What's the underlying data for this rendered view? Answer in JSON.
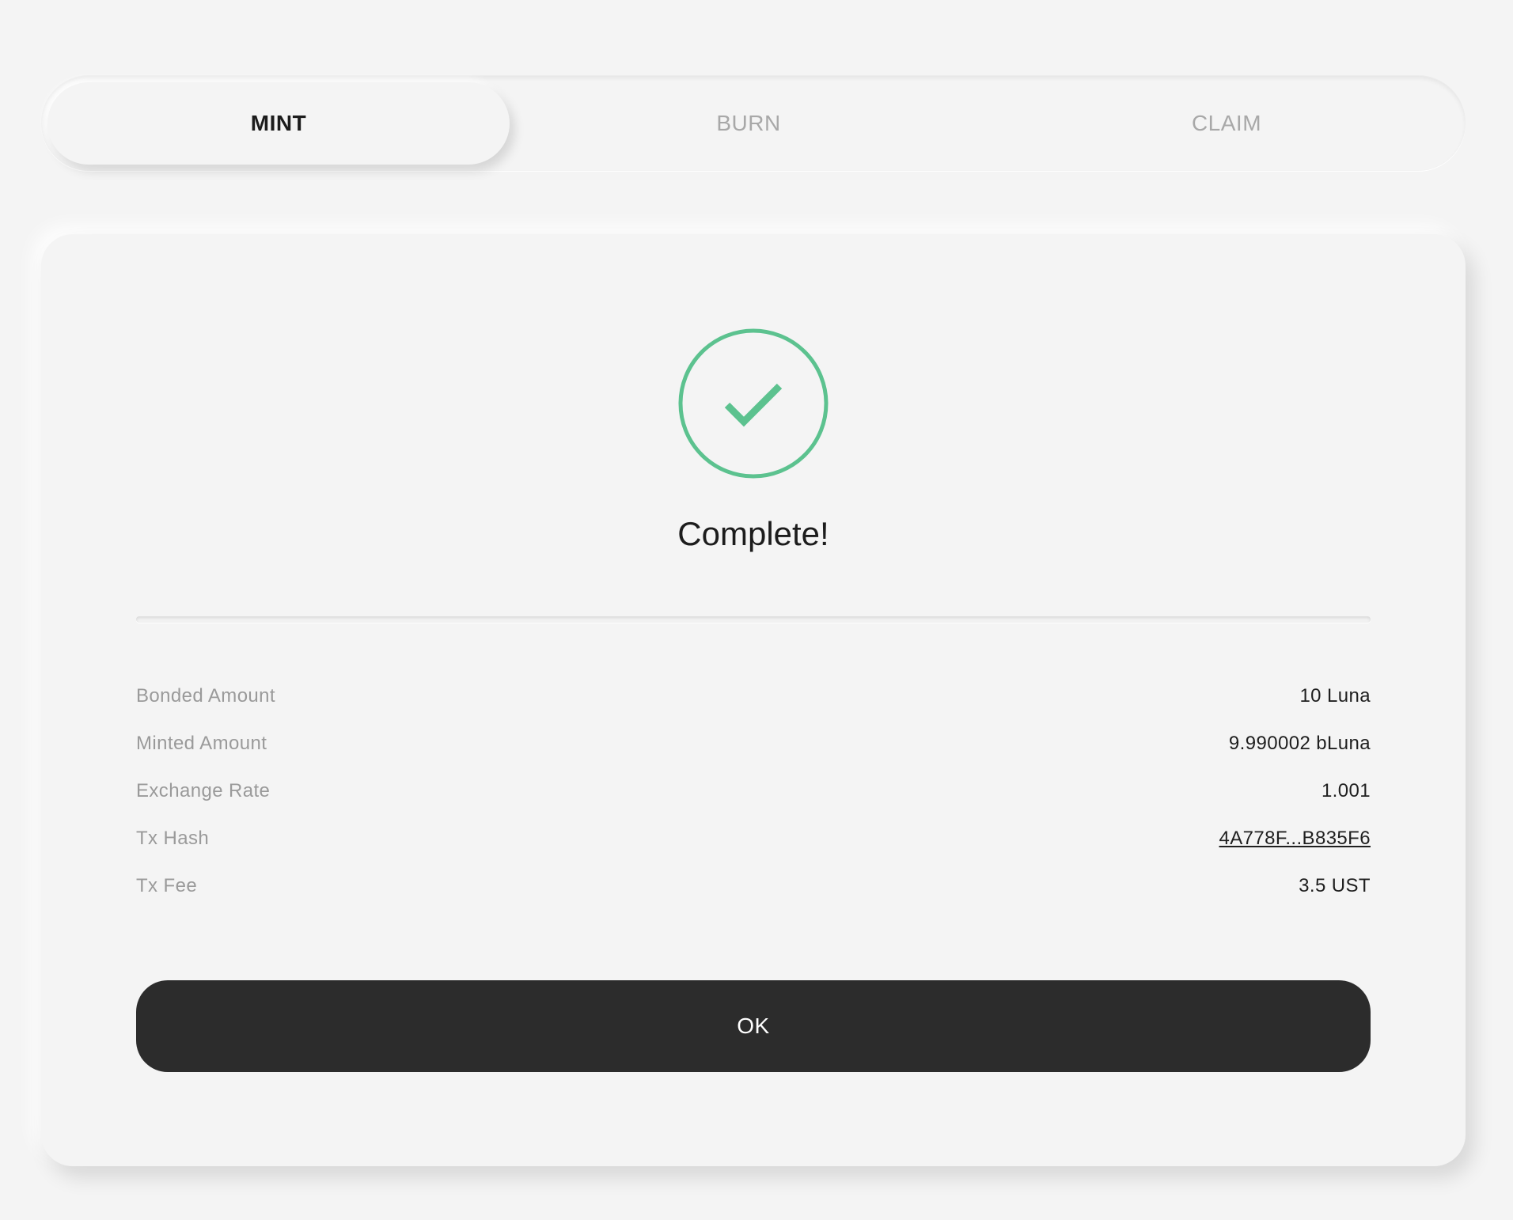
{
  "tabs": [
    {
      "label": "MINT",
      "active": true
    },
    {
      "label": "BURN",
      "active": false
    },
    {
      "label": "CLAIM",
      "active": false
    }
  ],
  "status": {
    "icon": "check-circle-icon",
    "color": "#5cc28f",
    "title": "Complete!"
  },
  "details": [
    {
      "label": "Bonded Amount",
      "value": "10 Luna"
    },
    {
      "label": "Minted Amount",
      "value": "9.990002 bLuna"
    },
    {
      "label": "Exchange Rate",
      "value": "1.001"
    },
    {
      "label": "Tx Hash",
      "value": "4A778F...B835F6",
      "link": true
    },
    {
      "label": "Tx Fee",
      "value": "3.5 UST"
    }
  ],
  "ok_button": {
    "label": "OK"
  },
  "colors": {
    "background": "#f4f4f4",
    "button": "#2c2c2c",
    "success": "#5cc28f",
    "muted_text": "#9a9a9a"
  }
}
